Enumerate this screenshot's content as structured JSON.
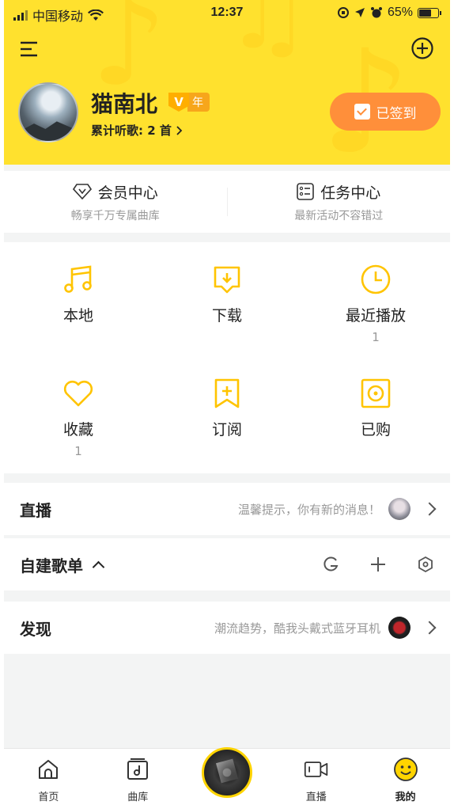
{
  "status_bar": {
    "carrier": "中国移动",
    "time": "12:37",
    "battery_percent": "65%",
    "battery_level": 0.65
  },
  "header": {
    "bg_color": "#ffe12e",
    "username": "猫南北",
    "vip_badge": "V",
    "vip_period": "年",
    "listen_count": "累计听歌: 2 首",
    "checkin_label": "已签到"
  },
  "quick_links": [
    {
      "icon": "diamond-icon",
      "title": "会员中心",
      "subtitle": "畅享千万专属曲库"
    },
    {
      "icon": "task-list-icon",
      "title": "任务中心",
      "subtitle": "最新活动不容错过"
    }
  ],
  "grid": [
    {
      "icon": "music-note-icon",
      "label": "本地",
      "count": ""
    },
    {
      "icon": "download-icon",
      "label": "下载",
      "count": ""
    },
    {
      "icon": "clock-icon",
      "label": "最近播放",
      "count": "1"
    },
    {
      "icon": "heart-icon",
      "label": "收藏",
      "count": "1"
    },
    {
      "icon": "bookmark-add-icon",
      "label": "订阅",
      "count": ""
    },
    {
      "icon": "purchased-disc-icon",
      "label": "已购",
      "count": ""
    }
  ],
  "rows": {
    "live": {
      "title": "直播",
      "hint": "温馨提示，你有新的消息！"
    },
    "playlists": {
      "title": "自建歌单"
    },
    "discover": {
      "title": "发现",
      "hint": "潮流趋势，酷我头戴式蓝牙耳机"
    }
  },
  "tabbar": [
    {
      "icon": "home-icon",
      "label": "首页",
      "active": false
    },
    {
      "icon": "library-icon",
      "label": "曲库",
      "active": false
    },
    {
      "icon": "now-playing-disc-icon",
      "label": "",
      "active": false
    },
    {
      "icon": "live-video-icon",
      "label": "直播",
      "active": false
    },
    {
      "icon": "smiley-icon",
      "label": "我的",
      "active": true
    }
  ],
  "accent_color": "#ffd400"
}
